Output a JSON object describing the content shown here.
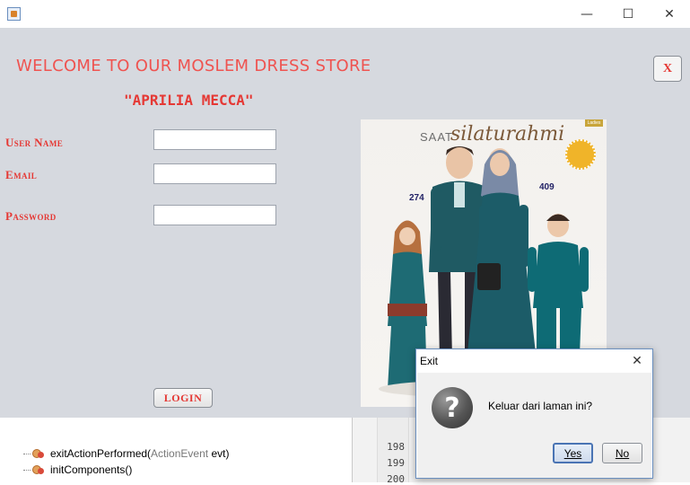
{
  "titlebar": {
    "minimize_glyph": "—",
    "maximize_glyph": "☐",
    "close_glyph": "✕"
  },
  "form": {
    "welcome": "WELCOME TO OUR MOSLEM DRESS STORE",
    "store_name": "\"APRILIA MECCA\"",
    "username_label": "User Name",
    "email_label": "Email",
    "password_label": "Password",
    "username_value": "",
    "email_value": "",
    "password_value": "",
    "close_button_label": "X",
    "login_button_label": "LOGIN",
    "accent_color": "#e53935"
  },
  "catalog": {
    "title": "SAAT",
    "script_title": "silaturahmi",
    "tag": "Ladies",
    "price_left": "274",
    "price_right": "409"
  },
  "ide": {
    "tree_items": [
      {
        "name": "exitActionPerformed",
        "params_type": "ActionEvent",
        "params_name": "evt"
      },
      {
        "name": "initComponents",
        "params_type": "",
        "params_name": ""
      }
    ],
    "line_numbers": [
      "198",
      "199",
      "200"
    ]
  },
  "dialog": {
    "title": "Exit",
    "close_glyph": "✕",
    "icon": "question-icon",
    "message": "Keluar dari laman ini?",
    "yes_label": "Yes",
    "no_label": "No"
  }
}
